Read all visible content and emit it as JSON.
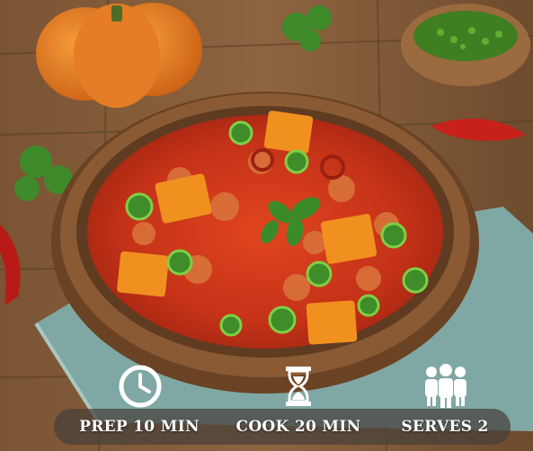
{
  "prep": {
    "icon": "clock-icon",
    "label": "PREP 10 MIN"
  },
  "cook": {
    "icon": "hourglass-icon",
    "label": "COOK 20 MIN"
  },
  "serves": {
    "icon": "people-icon",
    "label": "SERVES 2"
  },
  "colors": {
    "overlay": "#46403a",
    "text": "#ffffff",
    "stew": "#c8321a",
    "bowl": "#8a5a34",
    "napkin": "#7fa7a3"
  }
}
